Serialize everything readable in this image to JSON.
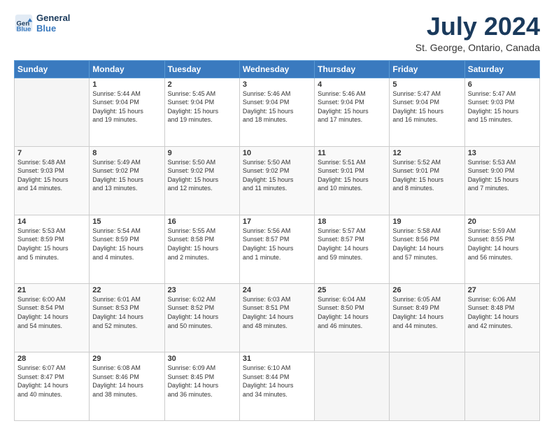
{
  "logo": {
    "line1": "General",
    "line2": "Blue"
  },
  "title": "July 2024",
  "subtitle": "St. George, Ontario, Canada",
  "days_of_week": [
    "Sunday",
    "Monday",
    "Tuesday",
    "Wednesday",
    "Thursday",
    "Friday",
    "Saturday"
  ],
  "weeks": [
    [
      {
        "day": "",
        "info": ""
      },
      {
        "day": "1",
        "info": "Sunrise: 5:44 AM\nSunset: 9:04 PM\nDaylight: 15 hours\nand 19 minutes."
      },
      {
        "day": "2",
        "info": "Sunrise: 5:45 AM\nSunset: 9:04 PM\nDaylight: 15 hours\nand 19 minutes."
      },
      {
        "day": "3",
        "info": "Sunrise: 5:46 AM\nSunset: 9:04 PM\nDaylight: 15 hours\nand 18 minutes."
      },
      {
        "day": "4",
        "info": "Sunrise: 5:46 AM\nSunset: 9:04 PM\nDaylight: 15 hours\nand 17 minutes."
      },
      {
        "day": "5",
        "info": "Sunrise: 5:47 AM\nSunset: 9:04 PM\nDaylight: 15 hours\nand 16 minutes."
      },
      {
        "day": "6",
        "info": "Sunrise: 5:47 AM\nSunset: 9:03 PM\nDaylight: 15 hours\nand 15 minutes."
      }
    ],
    [
      {
        "day": "7",
        "info": "Sunrise: 5:48 AM\nSunset: 9:03 PM\nDaylight: 15 hours\nand 14 minutes."
      },
      {
        "day": "8",
        "info": "Sunrise: 5:49 AM\nSunset: 9:02 PM\nDaylight: 15 hours\nand 13 minutes."
      },
      {
        "day": "9",
        "info": "Sunrise: 5:50 AM\nSunset: 9:02 PM\nDaylight: 15 hours\nand 12 minutes."
      },
      {
        "day": "10",
        "info": "Sunrise: 5:50 AM\nSunset: 9:02 PM\nDaylight: 15 hours\nand 11 minutes."
      },
      {
        "day": "11",
        "info": "Sunrise: 5:51 AM\nSunset: 9:01 PM\nDaylight: 15 hours\nand 10 minutes."
      },
      {
        "day": "12",
        "info": "Sunrise: 5:52 AM\nSunset: 9:01 PM\nDaylight: 15 hours\nand 8 minutes."
      },
      {
        "day": "13",
        "info": "Sunrise: 5:53 AM\nSunset: 9:00 PM\nDaylight: 15 hours\nand 7 minutes."
      }
    ],
    [
      {
        "day": "14",
        "info": "Sunrise: 5:53 AM\nSunset: 8:59 PM\nDaylight: 15 hours\nand 5 minutes."
      },
      {
        "day": "15",
        "info": "Sunrise: 5:54 AM\nSunset: 8:59 PM\nDaylight: 15 hours\nand 4 minutes."
      },
      {
        "day": "16",
        "info": "Sunrise: 5:55 AM\nSunset: 8:58 PM\nDaylight: 15 hours\nand 2 minutes."
      },
      {
        "day": "17",
        "info": "Sunrise: 5:56 AM\nSunset: 8:57 PM\nDaylight: 15 hours\nand 1 minute."
      },
      {
        "day": "18",
        "info": "Sunrise: 5:57 AM\nSunset: 8:57 PM\nDaylight: 14 hours\nand 59 minutes."
      },
      {
        "day": "19",
        "info": "Sunrise: 5:58 AM\nSunset: 8:56 PM\nDaylight: 14 hours\nand 57 minutes."
      },
      {
        "day": "20",
        "info": "Sunrise: 5:59 AM\nSunset: 8:55 PM\nDaylight: 14 hours\nand 56 minutes."
      }
    ],
    [
      {
        "day": "21",
        "info": "Sunrise: 6:00 AM\nSunset: 8:54 PM\nDaylight: 14 hours\nand 54 minutes."
      },
      {
        "day": "22",
        "info": "Sunrise: 6:01 AM\nSunset: 8:53 PM\nDaylight: 14 hours\nand 52 minutes."
      },
      {
        "day": "23",
        "info": "Sunrise: 6:02 AM\nSunset: 8:52 PM\nDaylight: 14 hours\nand 50 minutes."
      },
      {
        "day": "24",
        "info": "Sunrise: 6:03 AM\nSunset: 8:51 PM\nDaylight: 14 hours\nand 48 minutes."
      },
      {
        "day": "25",
        "info": "Sunrise: 6:04 AM\nSunset: 8:50 PM\nDaylight: 14 hours\nand 46 minutes."
      },
      {
        "day": "26",
        "info": "Sunrise: 6:05 AM\nSunset: 8:49 PM\nDaylight: 14 hours\nand 44 minutes."
      },
      {
        "day": "27",
        "info": "Sunrise: 6:06 AM\nSunset: 8:48 PM\nDaylight: 14 hours\nand 42 minutes."
      }
    ],
    [
      {
        "day": "28",
        "info": "Sunrise: 6:07 AM\nSunset: 8:47 PM\nDaylight: 14 hours\nand 40 minutes."
      },
      {
        "day": "29",
        "info": "Sunrise: 6:08 AM\nSunset: 8:46 PM\nDaylight: 14 hours\nand 38 minutes."
      },
      {
        "day": "30",
        "info": "Sunrise: 6:09 AM\nSunset: 8:45 PM\nDaylight: 14 hours\nand 36 minutes."
      },
      {
        "day": "31",
        "info": "Sunrise: 6:10 AM\nSunset: 8:44 PM\nDaylight: 14 hours\nand 34 minutes."
      },
      {
        "day": "",
        "info": ""
      },
      {
        "day": "",
        "info": ""
      },
      {
        "day": "",
        "info": ""
      }
    ]
  ]
}
